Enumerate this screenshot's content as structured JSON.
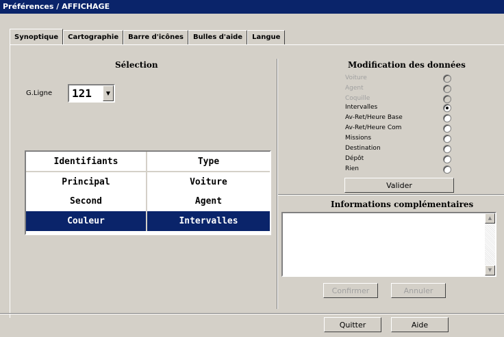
{
  "window": {
    "title": "Préférences / AFFICHAGE"
  },
  "tabs": [
    "Synoptique",
    "Cartographie",
    "Barre d'icônes",
    "Bulles d'aide",
    "Langue"
  ],
  "selection": {
    "title": "Sélection",
    "combo_label": "G.Ligne",
    "combo_value": "121"
  },
  "grid": {
    "headers": [
      "Identifiants",
      "Type"
    ],
    "rows": [
      [
        "Principal",
        "Voiture"
      ],
      [
        "Second",
        "Agent"
      ],
      [
        "Couleur",
        "Intervalles"
      ]
    ],
    "selected_row": 2
  },
  "modification": {
    "title": "Modification des données",
    "options": [
      {
        "label": "Voiture",
        "disabled": true,
        "checked": false
      },
      {
        "label": "Agent",
        "disabled": true,
        "checked": false
      },
      {
        "label": "Coquille",
        "disabled": true,
        "checked": false
      },
      {
        "label": "Intervalles",
        "disabled": false,
        "checked": true
      },
      {
        "label": "Av-Ret/Heure Base",
        "disabled": false,
        "checked": false
      },
      {
        "label": "Av-Ret/Heure Com",
        "disabled": false,
        "checked": false
      },
      {
        "label": "Missions",
        "disabled": false,
        "checked": false
      },
      {
        "label": "Destination",
        "disabled": false,
        "checked": false
      },
      {
        "label": "Dépôt",
        "disabled": false,
        "checked": false
      },
      {
        "label": "Rien",
        "disabled": false,
        "checked": false
      }
    ],
    "validate_label": "Valider"
  },
  "info": {
    "title": "Informations complémentaires",
    "text": "",
    "confirm_label": "Confirmer",
    "cancel_label": "Annuler"
  },
  "footer": {
    "quit_label": "Quitter",
    "help_label": "Aide"
  },
  "colors": {
    "title_bar": "#0a246a",
    "selection": "#0a246a",
    "face": "#d4d0c8"
  }
}
